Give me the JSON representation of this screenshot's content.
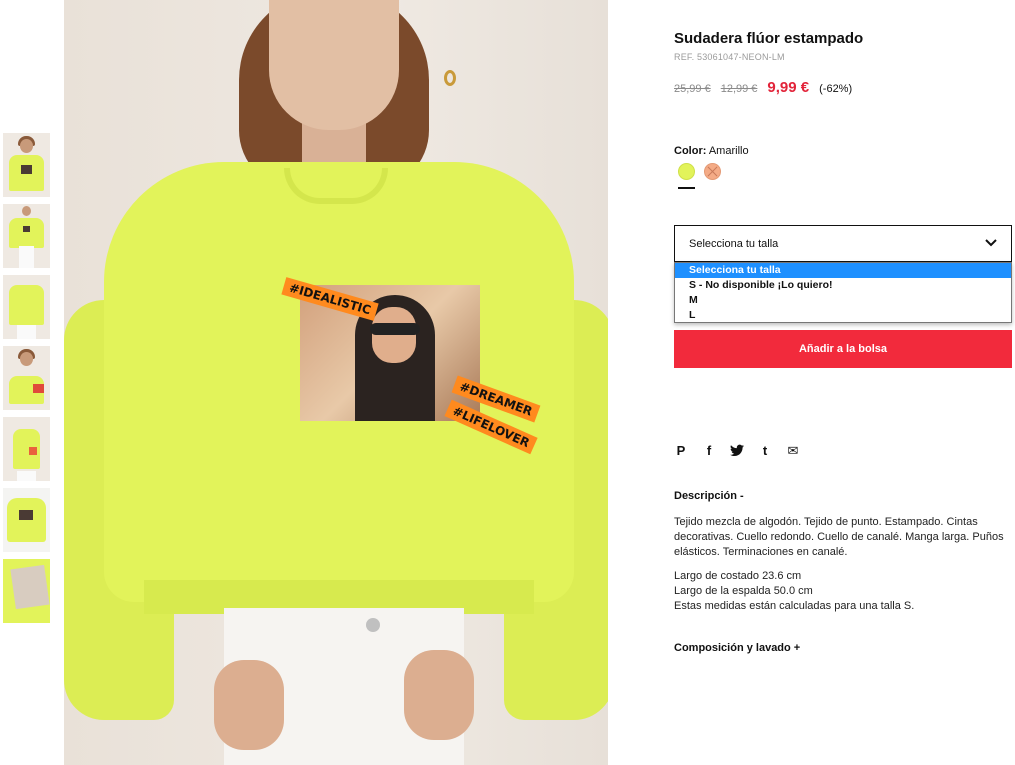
{
  "thumbnails": [
    {
      "name": "thumb-1"
    },
    {
      "name": "thumb-2"
    },
    {
      "name": "thumb-3"
    },
    {
      "name": "thumb-4"
    },
    {
      "name": "thumb-5"
    },
    {
      "name": "thumb-6"
    },
    {
      "name": "thumb-7"
    }
  ],
  "image_print": {
    "tag1": "#IDEALISTIC",
    "tag2": "#DREAMER",
    "tag3": "#LIFELOVER"
  },
  "product": {
    "title": "Sudadera flúor estampado",
    "ref": "REF. 53061047-NEON-LM",
    "price_original": "25,99 €",
    "price_previous": "12,99 €",
    "price_current": "9,99 €",
    "discount": "(-62%)"
  },
  "color": {
    "label": "Color:",
    "value": "Amarillo",
    "swatches": [
      {
        "name": "yellow",
        "hex": "#e2f35a",
        "selected": true
      },
      {
        "name": "orange",
        "hex": "#f4ab86",
        "selected": false,
        "unavailable": true
      }
    ]
  },
  "size": {
    "placeholder": "Selecciona tu talla",
    "options": [
      {
        "label": "Selecciona tu talla",
        "selected": true
      },
      {
        "label": "S - No disponible ¡Lo quiero!",
        "selected": false
      },
      {
        "label": "M",
        "selected": false
      },
      {
        "label": "L",
        "selected": false
      }
    ]
  },
  "cart": {
    "add_label": "Añadir a la bolsa"
  },
  "share": {
    "pinterest": "P",
    "facebook": "f",
    "twitter": "t",
    "tumblr": "t",
    "email": "✉"
  },
  "description": {
    "heading": "Descripción -",
    "text": "Tejido mezcla de algodón. Tejido de punto. Estampado. Cintas decorativas. Cuello redondo. Cuello de canalé. Manga larga. Puños elásticos. Terminaciones en canalé.",
    "measure_1": "Largo de costado 23.6 cm",
    "measure_2": "Largo de la espalda 50.0 cm",
    "measure_note": "Estas medidas están calculadas para una talla S."
  },
  "composition": {
    "heading": "Composición y lavado +"
  },
  "colors": {
    "accent_red": "#f22a3c",
    "price_red": "#e2243a",
    "select_blue": "#1e90ff",
    "neon_yellow": "#e2f35a"
  }
}
